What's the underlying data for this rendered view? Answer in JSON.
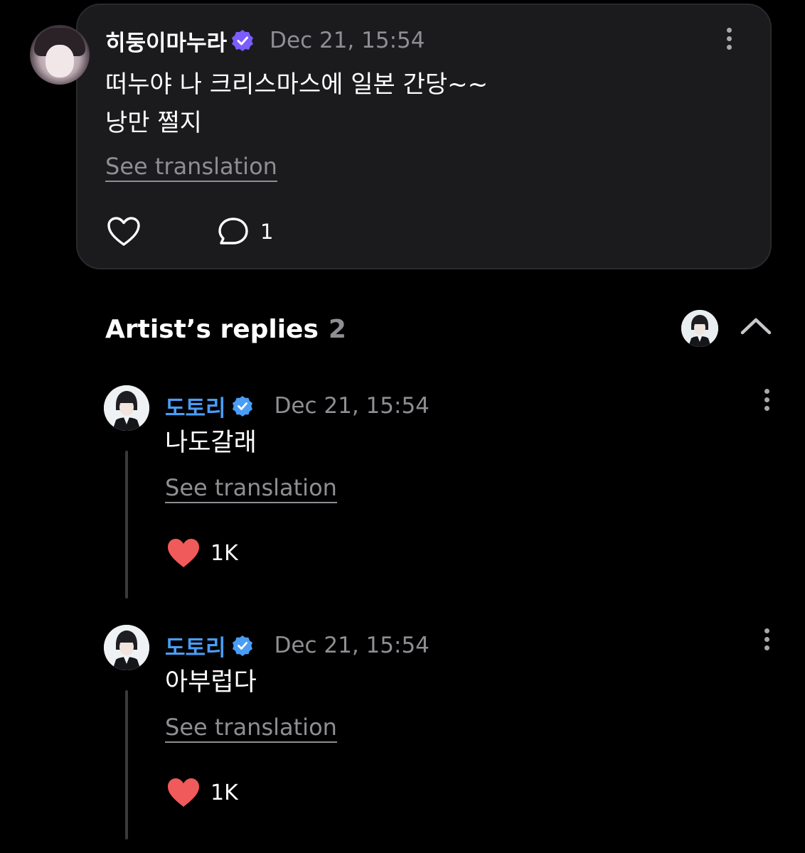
{
  "post": {
    "author": "히둥이마누라",
    "time": "Dec 21, 15:54",
    "lines": [
      "떠누야 나 크리스마스에 일본 간당~~",
      "낭만 쩔지"
    ],
    "see_translation": "See translation",
    "comment_count": "1"
  },
  "artist_replies": {
    "title": "Artist’s replies",
    "count": "2",
    "items": [
      {
        "author": "도토리",
        "time": "Dec 21, 15:54",
        "text": "나도갈래",
        "see_translation": "See translation",
        "likes": "1K"
      },
      {
        "author": "도토리",
        "time": "Dec 21, 15:54",
        "text": "아부럽다",
        "see_translation": "See translation",
        "likes": "1K"
      }
    ]
  },
  "colors": {
    "background": "#000000",
    "card": "#1b1b1d",
    "secondary_text": "#8e8e93",
    "artist_name": "#4a9df5",
    "verified_badge_purple": "#7a5cff",
    "verified_badge_blue": "#4a9df5",
    "liked_heart": "#f05a5a"
  },
  "icons": {
    "post_like": "heart-outline-icon",
    "post_comment": "speech-bubble-icon",
    "reply_like": "heart-filled-icon",
    "more": "vertical-ellipsis-icon",
    "collapse": "chevron-up-icon",
    "verified": "verified-badge-icon"
  }
}
